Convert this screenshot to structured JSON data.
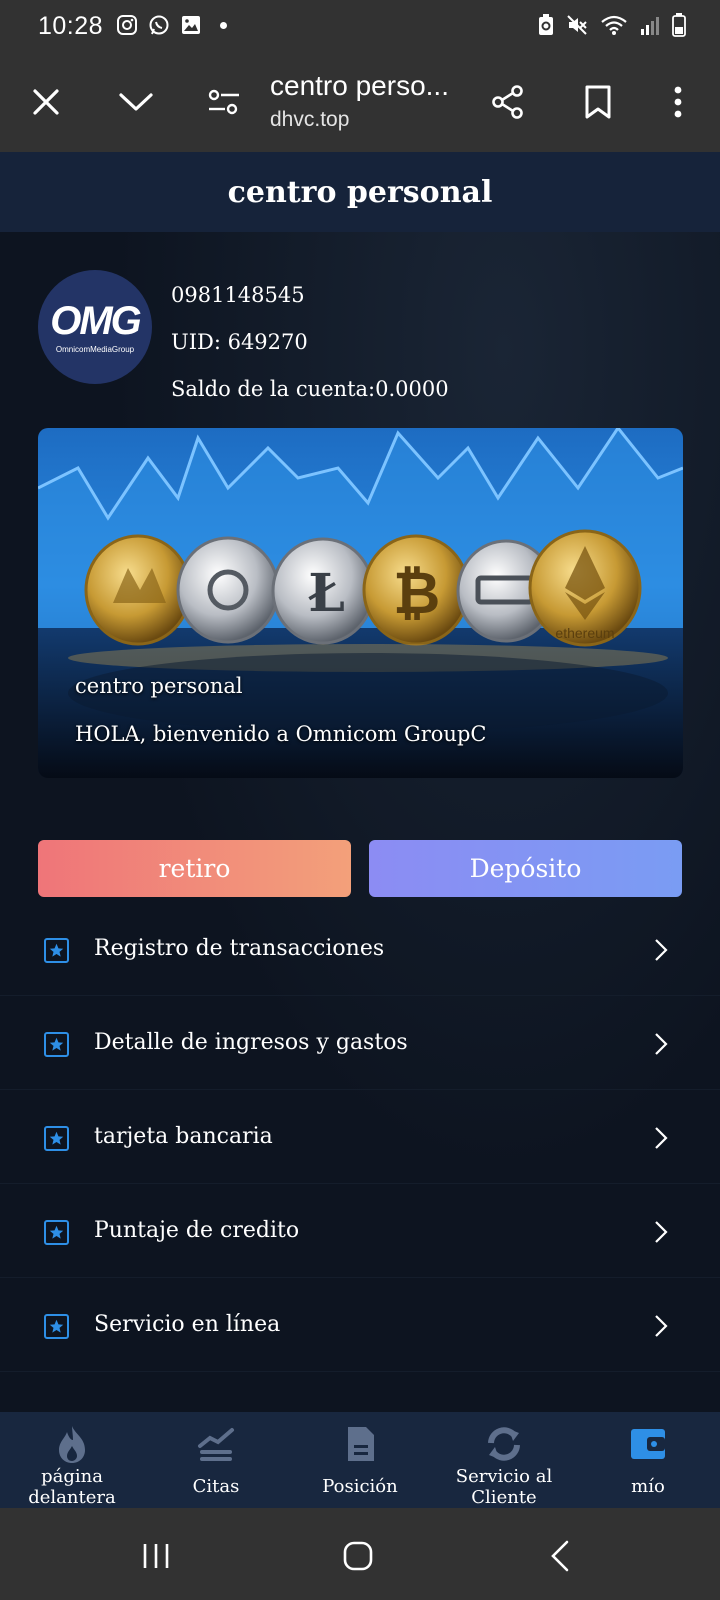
{
  "status_bar": {
    "time": "10:28",
    "left_icons": [
      "instagram-icon",
      "whatsapp-icon",
      "gallery-icon"
    ],
    "right_icons": [
      "battery-saver-icon",
      "mute-icon",
      "wifi-icon",
      "signal-icon",
      "battery-icon"
    ]
  },
  "browser": {
    "title": "centro perso...",
    "url": "dhvc.top"
  },
  "page": {
    "title": "centro personal"
  },
  "profile": {
    "avatar_text": "OMG",
    "avatar_subtext": "OmnicomMediaGroup",
    "phone": "0981148545",
    "uid": "UID: 649270",
    "balance": "Saldo de la cuenta:0.0000"
  },
  "banner": {
    "title": "centro personal",
    "welcome": "HOLA, bienvenido a Omnicom GroupC",
    "coin_text": "ethereum"
  },
  "actions": {
    "withdraw": "retiro",
    "deposit": "Depósito"
  },
  "menu": [
    {
      "label": "Registro de transacciones"
    },
    {
      "label": "Detalle de ingresos y gastos"
    },
    {
      "label": "tarjeta bancaria"
    },
    {
      "label": "Puntaje de credito"
    },
    {
      "label": "Servicio en línea"
    }
  ],
  "bottom_nav": [
    {
      "label": "página\ndelantera",
      "icon": "flame-icon"
    },
    {
      "label": "Citas",
      "icon": "chart-lines-icon"
    },
    {
      "label": "Posición",
      "icon": "document-icon"
    },
    {
      "label": "Servicio al\nCliente",
      "icon": "refresh-icon"
    },
    {
      "label": "mío",
      "icon": "wallet-icon"
    }
  ],
  "colors": {
    "accent_blue": "#2e8fe6",
    "withdraw_gradient": [
      "#ef7579",
      "#f3a07a"
    ],
    "deposit_gradient": [
      "#8c8cf3",
      "#7a9cf3"
    ],
    "nav_active": "#2e8fe6"
  }
}
